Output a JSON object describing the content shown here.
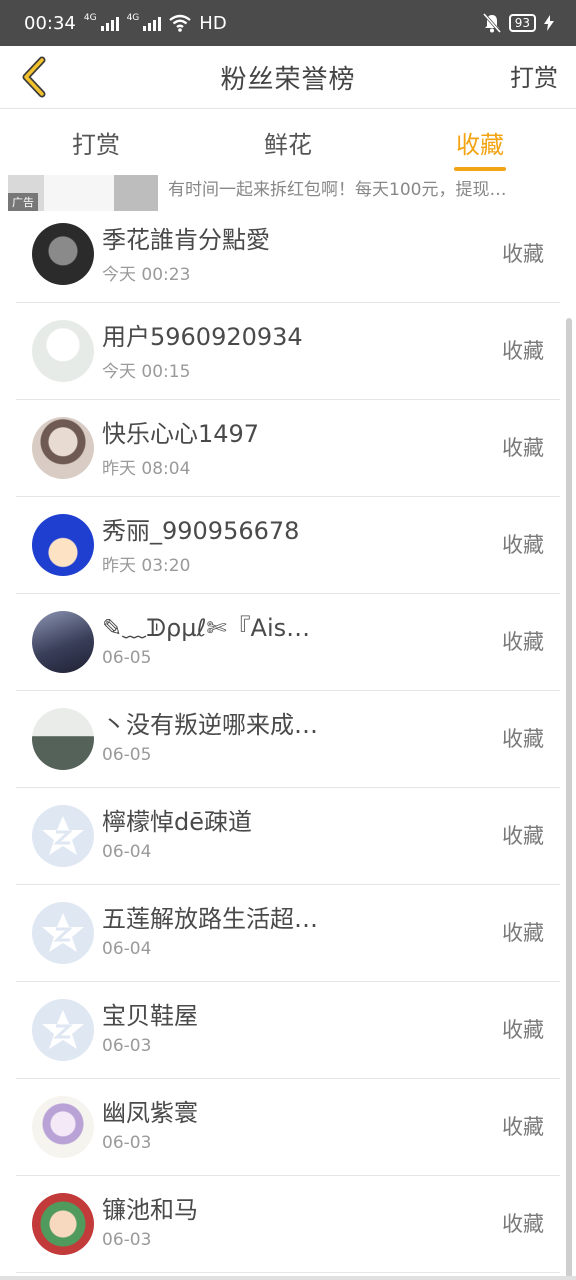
{
  "status_bar": {
    "time": "00:34",
    "network_1": "4G",
    "network_2": "4G",
    "hd": "HD",
    "battery": "93"
  },
  "header": {
    "title": "粉丝荣誉榜",
    "action_label": "打赏"
  },
  "tabs": [
    {
      "label": "打赏",
      "active": false
    },
    {
      "label": "鲜花",
      "active": false
    },
    {
      "label": "收藏",
      "active": true
    }
  ],
  "ad": {
    "tag": "广告",
    "text": "有时间一起来拆红包啊！每天100元，提现…"
  },
  "list": [
    {
      "name": "季花誰肯分點愛",
      "time": "今天 00:23",
      "action": "收藏",
      "avatar": "dark-portrait"
    },
    {
      "name": "用户5960920934",
      "time": "今天 00:15",
      "action": "收藏",
      "avatar": "default-silhouette"
    },
    {
      "name": "快乐心心1497",
      "time": "昨天 08:04",
      "action": "收藏",
      "avatar": "girl-photo"
    },
    {
      "name": "秀丽_990956678",
      "time": "昨天 03:20",
      "action": "收藏",
      "avatar": "anime-blue-hair"
    },
    {
      "name": "✎﹏ᗫρµℓ✄『Ais…",
      "time": "06-05",
      "action": "收藏",
      "avatar": "night-scene"
    },
    {
      "name": "丶没有叛逆哪来成…",
      "time": "06-05",
      "action": "收藏",
      "avatar": "scenery"
    },
    {
      "name": "檸檬悼dē疎道",
      "time": "06-04",
      "action": "收藏",
      "avatar": "qzone-default"
    },
    {
      "name": "五莲解放路生活超…",
      "time": "06-04",
      "action": "收藏",
      "avatar": "qzone-default"
    },
    {
      "name": "宝贝鞋屋",
      "time": "06-03",
      "action": "收藏",
      "avatar": "qzone-default"
    },
    {
      "name": "幽凤紫寰",
      "time": "06-03",
      "action": "收藏",
      "avatar": "anime-purple"
    },
    {
      "name": "镰池和马",
      "time": "06-03",
      "action": "收藏",
      "avatar": "anime-green"
    }
  ]
}
